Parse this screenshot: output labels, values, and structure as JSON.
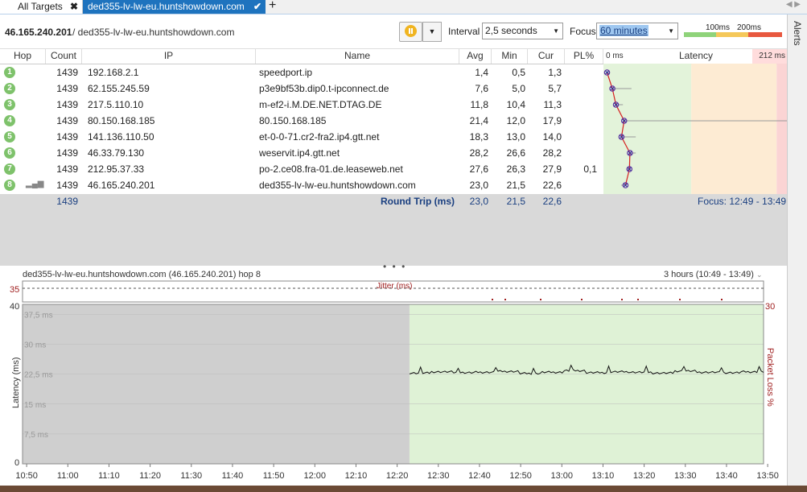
{
  "tabs": [
    {
      "label": "All Targets"
    },
    {
      "label": "ded355-lv-lw-eu.huntshowdown.com"
    }
  ],
  "toolbar": {
    "target_ip": "46.165.240.201",
    "target_host": "/ ded355-lv-lw-eu.huntshowdown.com",
    "interval_label": "Interval",
    "interval_value": "2,5 seconds",
    "focus_label": "Focus",
    "focus_value": "60 minutes",
    "legend_100": "100ms",
    "legend_200": "200ms",
    "colors": {
      "green": "#8fd37a",
      "yellow": "#f5c85a",
      "red": "#e8583f"
    }
  },
  "alerts_label": "Alerts",
  "table": {
    "headers": [
      "Hop",
      "Count",
      "IP",
      "Name",
      "Avg",
      "Min",
      "Cur",
      "PL%",
      "0 ms",
      "Latency",
      "212 ms"
    ],
    "rows": [
      {
        "hop": "1",
        "count": "1439",
        "ip": "192.168.2.1",
        "name": "speedport.ip",
        "avg": "1,4",
        "min": "0,5",
        "cur": "1,3",
        "pl": ""
      },
      {
        "hop": "2",
        "count": "1439",
        "ip": "62.155.245.59",
        "name": "p3e9bf53b.dip0.t-ipconnect.de",
        "avg": "7,6",
        "min": "5,0",
        "cur": "5,7",
        "pl": ""
      },
      {
        "hop": "3",
        "count": "1439",
        "ip": "217.5.110.10",
        "name": "m-ef2-i.M.DE.NET.DTAG.DE",
        "avg": "11,8",
        "min": "10,4",
        "cur": "11,3",
        "pl": ""
      },
      {
        "hop": "4",
        "count": "1439",
        "ip": "80.150.168.185",
        "name": "80.150.168.185",
        "avg": "21,4",
        "min": "12,0",
        "cur": "17,9",
        "pl": ""
      },
      {
        "hop": "5",
        "count": "1439",
        "ip": "141.136.110.50",
        "name": "et-0-0-71.cr2-fra2.ip4.gtt.net",
        "avg": "18,3",
        "min": "13,0",
        "cur": "14,0",
        "pl": ""
      },
      {
        "hop": "6",
        "count": "1439",
        "ip": "46.33.79.130",
        "name": "weservit.ip4.gtt.net",
        "avg": "28,2",
        "min": "26,6",
        "cur": "28,2",
        "pl": ""
      },
      {
        "hop": "7",
        "count": "1439",
        "ip": "212.95.37.33",
        "name": "po-2.ce08.fra-01.de.leaseweb.net",
        "avg": "27,6",
        "min": "26,3",
        "cur": "27,9",
        "pl": "0,1"
      },
      {
        "hop": "8",
        "count": "1439",
        "ip": "46.165.240.201",
        "name": "ded355-lv-lw-eu.huntshowdown.com",
        "avg": "23,0",
        "min": "21,5",
        "cur": "22,6",
        "pl": ""
      }
    ],
    "summary": {
      "count": "1439",
      "label": "Round Trip (ms)",
      "avg": "23,0",
      "min": "21,5",
      "cur": "22,6",
      "focus": "Focus: 12:49 - 13:49"
    }
  },
  "hop_graph": {
    "scale_max_ms": 212,
    "thresholds_ms": [
      100,
      200
    ],
    "points": [
      {
        "avg": 1.4,
        "max": 4
      },
      {
        "avg": 7.6,
        "max": 30
      },
      {
        "avg": 11.8,
        "max": 20
      },
      {
        "avg": 21.4,
        "max": 212
      },
      {
        "avg": 18.3,
        "max": 35
      },
      {
        "avg": 28.2,
        "max": 35
      },
      {
        "avg": 27.6,
        "max": 25
      },
      {
        "avg": 23.0,
        "max": 18
      }
    ]
  },
  "divider": "• • •",
  "chart": {
    "title": "ded355-lv-lw-eu.huntshowdown.com (46.165.240.201) hop 8",
    "range": "3 hours (10:49 - 13:49)",
    "jitter_label": "Jitter (ms)",
    "jitter_axis_max": "35",
    "y_label": "Latency (ms)",
    "y2_label": "Packet Loss %",
    "y2_max": "30",
    "y_ticks_left": [
      "40",
      "0"
    ],
    "y_ticks_inner": [
      "37,5 ms",
      "30 ms",
      "22,5 ms",
      "15 ms",
      "7,5 ms"
    ],
    "x_ticks": [
      "10:50",
      "11:00",
      "11:10",
      "11:20",
      "11:30",
      "11:40",
      "11:50",
      "12:00",
      "12:10",
      "12:20",
      "12:30",
      "12:40",
      "12:50",
      "13:00",
      "13:10",
      "13:20",
      "13:30",
      "13:40",
      "13:50"
    ]
  },
  "chart_data": {
    "type": "line",
    "title": "ded355-lv-lw-eu.huntshowdown.com (46.165.240.201) hop 8",
    "xlabel": "",
    "ylabel": "Latency (ms)",
    "ylim": [
      0,
      40
    ],
    "x_range": [
      "10:49",
      "13:49"
    ],
    "data_start": "12:23",
    "series": [
      {
        "values": [
          22.8,
          23.1,
          22.9,
          23.0,
          23.2,
          22.7,
          23.0,
          23.4,
          22.9,
          23.1,
          23.0,
          22.8,
          23.3,
          23.0,
          22.9,
          23.1
        ]
      }
    ]
  }
}
